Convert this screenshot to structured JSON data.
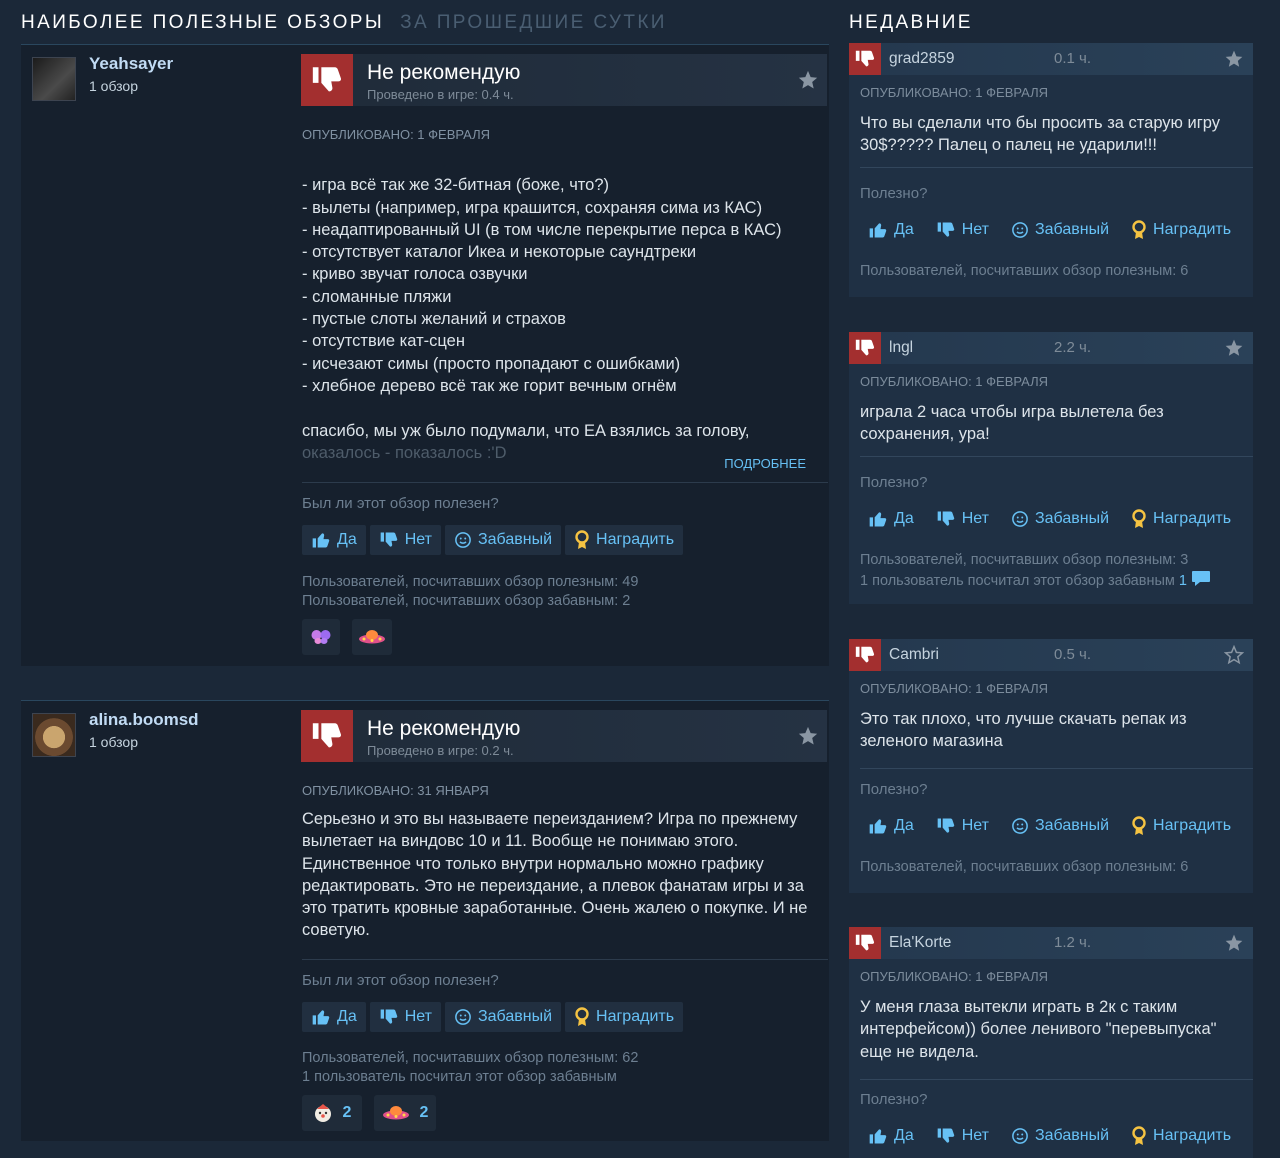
{
  "header_left": {
    "title": "НАИБОЛЕЕ ПОЛЕЗНЫЕ ОБЗОРЫ",
    "subtitle": "ЗА ПРОШЕДШИЕ СУТКИ"
  },
  "header_right": {
    "title": "НЕДАВНИЕ"
  },
  "vote_labels": {
    "question": "Был ли этот обзор полезен?",
    "yes": "Да",
    "no": "Нет",
    "funny": "Забавный",
    "award": "Наградить"
  },
  "reviews": [
    {
      "author": "Yeahsayer",
      "author_reviews": "1 обзор",
      "verdict": "Не рекомендую",
      "hours": "Проведено в игре: 0.4 ч.",
      "posted": "ОПУБЛИКОВАНО: 1 ФЕВРАЛЯ",
      "text": "- игра всё так же 32-битная (боже, что?)\n- вылеты (например, игра крашится, сохраняя сима из КАС)\n- неадаптированный UI (в том числе перекрытие перса в КАС)\n- отсутствует каталог Икеа и некоторые саундтреки\n- криво звучат голоса озвучки\n- сломанные пляжи\n- пустые слоты желаний и страхов\n- отсутствие кат-сцен\n- исчезают симы (просто пропадают с ошибками)\n- хлебное дерево всё так же горит вечным огнём\n\nспасибо, мы уж было подумали, что EA взялись за голову,",
      "text_faded": "оказалось - показалось :'D",
      "more": "ПОДРОБНЕЕ",
      "stats_helpful": "Пользователей, посчитавших обзор полезным: 49",
      "stats_funny": "Пользователей, посчитавших обзор забавным: 2",
      "awards": [
        {
          "icon": "butterfly-award-icon",
          "count": ""
        },
        {
          "icon": "ufo-award-icon",
          "count": ""
        }
      ]
    },
    {
      "author": "alina.boomsd",
      "author_reviews": "1 обзор",
      "verdict": "Не рекомендую",
      "hours": "Проведено в игре: 0.2 ч.",
      "posted": "ОПУБЛИКОВАНО: 31 ЯНВАРЯ",
      "text": "Серьезно и это вы называете переизданием? Игра по прежнему вылетает на виндовс 10 и 11. Вообще не понимаю этого. Единственное что только внутри нормально можно графику редактировать. Это не переиздание, а плевок фанатам игры и за это тратить кровные заработанные. Очень жалею о покупке. И не советую.",
      "stats_helpful": "Пользователей, посчитавших обзор полезным: 62",
      "stats_funny": "1 пользователь посчитал этот обзор забавным",
      "awards": [
        {
          "icon": "clown-award-icon",
          "count": "2"
        },
        {
          "icon": "ufo-award-icon",
          "count": "2"
        }
      ]
    }
  ],
  "recent": [
    {
      "name": "grad2859",
      "hours": "0.1 ч.",
      "posted": "ОПУБЛИКОВАНО: 1 ФЕВРАЛЯ",
      "text": "Что вы сделали что бы просить за старую игру 30$????? Палец о палец не ударили!!!",
      "question": "Полезно?",
      "stats": "Пользователей, посчитавших обзор полезным: 6",
      "stats2": "",
      "stats2_count": ""
    },
    {
      "name": "lngl",
      "hours": "2.2 ч.",
      "posted": "ОПУБЛИКОВАНО: 1 ФЕВРАЛЯ",
      "text": "играла 2 часа чтобы игра вылетела без сохранения, ура!",
      "question": "Полезно?",
      "stats": "Пользователей, посчитавших обзор полезным: 3",
      "stats2": "1 пользователь посчитал этот обзор забавным",
      "stats2_count": "1"
    },
    {
      "name": "Cambri",
      "hours": "0.5 ч.",
      "posted": "ОПУБЛИКОВАНО: 1 ФЕВРАЛЯ",
      "text": "Это так плохо, что лучше скачать репак из зеленого магазина",
      "question": "Полезно?",
      "stats": "Пользователей, посчитавших обзор полезным: 6",
      "stats2": "",
      "stats2_count": ""
    },
    {
      "name": "Ela'Korte",
      "hours": "1.2 ч.",
      "posted": "ОПУБЛИКОВАНО: 1 ФЕВРАЛЯ",
      "text": "У меня глаза вытекли играть в 2к с таким интерфейсом)) более ленивого \"перевыпуска\" еще не видела.",
      "question": "Полезно?",
      "stats": "",
      "stats2": "",
      "stats2_count": ""
    }
  ],
  "colors": {
    "accent": "#67c1f5",
    "thumbs_down_bg": "#a32f2f",
    "background": "#1b2838"
  }
}
